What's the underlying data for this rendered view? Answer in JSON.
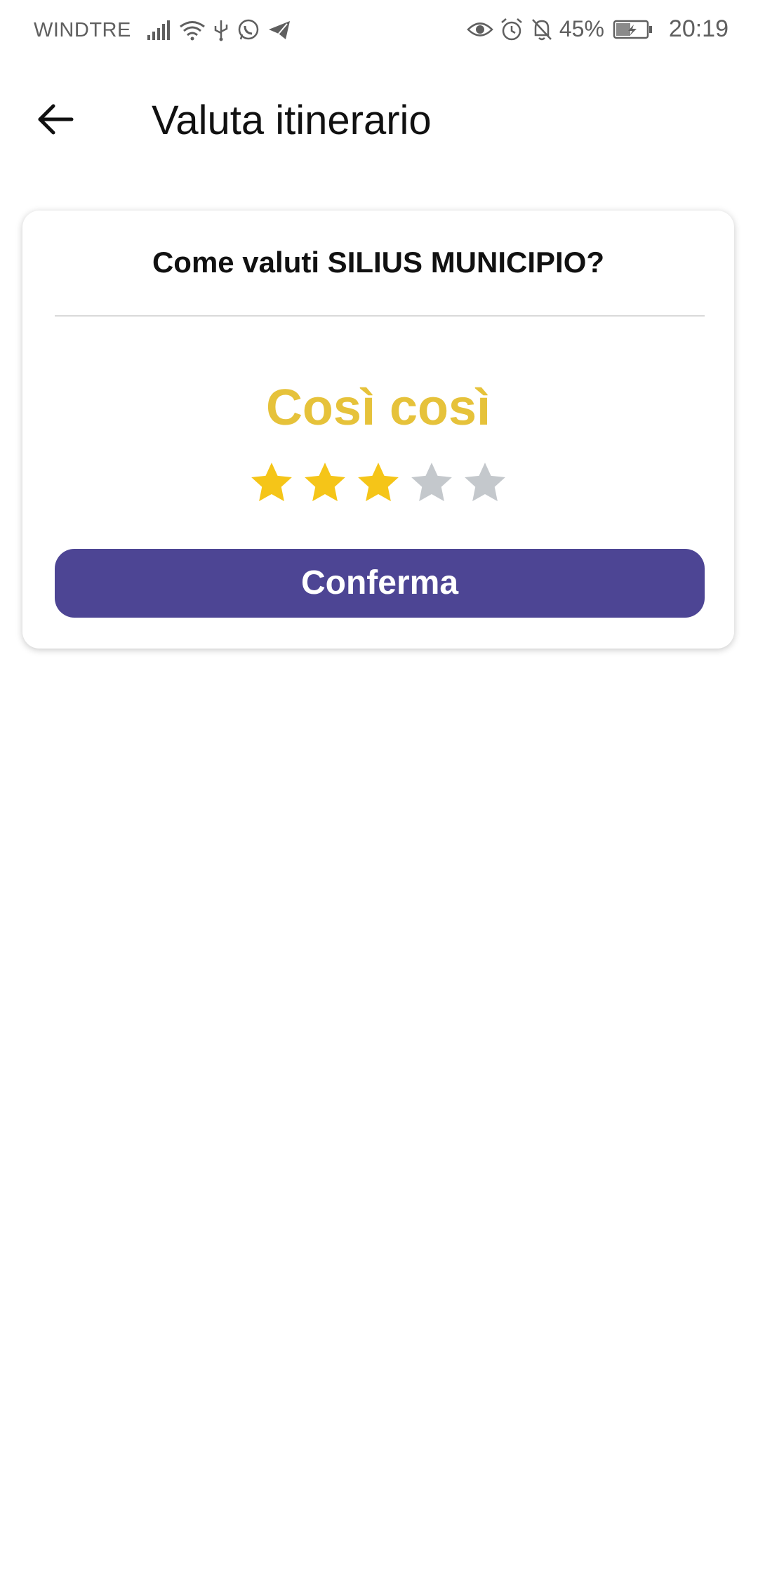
{
  "status_bar": {
    "carrier": "WINDTRE",
    "battery_percent": "45%",
    "time": "20:19",
    "icons_left": [
      "signal-icon",
      "wifi-icon",
      "usb-icon",
      "whatsapp-icon",
      "telegram-icon"
    ],
    "icons_right": [
      "eye-icon",
      "alarm-icon",
      "bell-off-icon",
      "battery-charging-icon"
    ]
  },
  "app_bar": {
    "title": "Valuta itinerario"
  },
  "rating_card": {
    "question": "Come valuti SILIUS MUNICIPIO?",
    "rating_label": "Così così",
    "rating": 3,
    "max_rating": 5,
    "confirm_label": "Conferma"
  },
  "colors": {
    "accent": "#4d4594",
    "star_filled": "#f5c518",
    "star_empty": "#c4c8cc",
    "rating_label": "#e6c23a"
  }
}
